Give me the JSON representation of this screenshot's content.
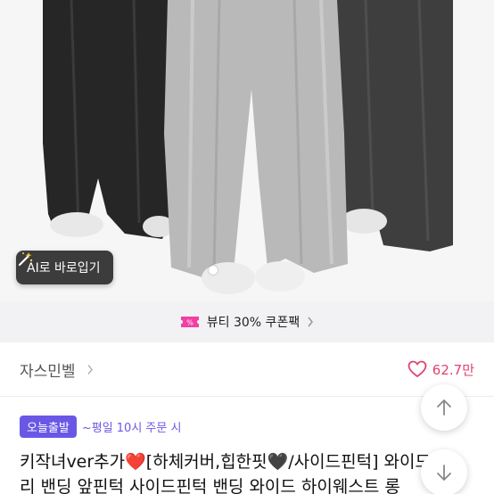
{
  "product_image": {
    "ai_button_label": "AI로 바로입기"
  },
  "coupon_banner": {
    "text": "뷰티 30% 쿠폰팩"
  },
  "store": {
    "name": "자스민벨",
    "likes": "62.7만"
  },
  "delivery": {
    "badge": "오늘출발",
    "note": "~평일 10시 주문 시"
  },
  "product": {
    "title_line1": "키작녀ver추가❤️[하체커버,힙한핏🖤/사이드핀턱] 와이드",
    "title_line2": "리 밴딩 앞핀턱 사이드핀턱 밴딩 와이드 하이웨스트 롱"
  },
  "icons": {
    "wand": "magic-wand-icon",
    "ticket": "coupon-ticket-icon",
    "heart": "heart-icon",
    "up": "arrow-up-icon",
    "down": "arrow-down-icon"
  },
  "colors": {
    "like_pink": "#e0436e",
    "delivery_purple": "#6b57e6",
    "coupon_pink": "#f23fa4"
  }
}
